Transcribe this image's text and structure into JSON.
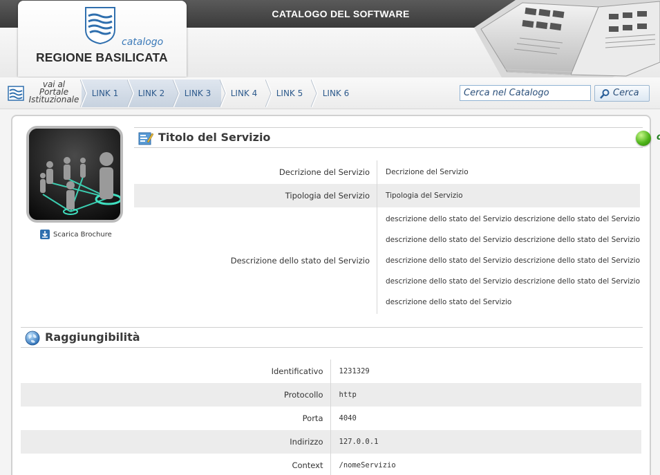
{
  "header": {
    "app_title": "CATALOGO DEL SOFTWARE",
    "logo_sub": "catalogo",
    "logo_main": "REGIONE BASILICATA"
  },
  "nav": {
    "portal_text": [
      "vai al",
      "Portale",
      "Istituzionale"
    ],
    "links": [
      {
        "label": "LINK 1",
        "active": true
      },
      {
        "label": "LINK 2",
        "active": true
      },
      {
        "label": "LINK 3",
        "active": true
      },
      {
        "label": "LINK 4",
        "active": false
      },
      {
        "label": "LINK 5",
        "active": false
      },
      {
        "label": "LINK 6",
        "active": false
      }
    ],
    "search_placeholder": "Cerca nel Catalogo",
    "search_button": "Cerca"
  },
  "service": {
    "brochure_label": "Scarica Brochure",
    "title": "Titolo del Servizio",
    "status": "online",
    "status_color": "#3fa811",
    "rows": [
      {
        "key": "Decrizione del Servizio",
        "value": "Decrizione del Servizio"
      },
      {
        "key": "Tipologia del Servizio",
        "value": "Tipologia del Servizio"
      }
    ],
    "stato_key": "Descrizione dello stato del Servizio",
    "stato_lines": [
      "descrizione dello stato del Servizio descrizione dello stato del Servizio",
      "descrizione dello stato del Servizio descrizione dello stato del Servizio",
      "descrizione dello stato del Servizio descrizione dello stato del Servizio",
      "descrizione dello stato del Servizio descrizione dello stato del Servizio",
      "descrizione dello stato del Servizio"
    ]
  },
  "reach": {
    "title": "Raggiungibilità",
    "rows": [
      {
        "key": "Identificativo",
        "value": "1231329"
      },
      {
        "key": "Protocollo",
        "value": "http"
      },
      {
        "key": "Porta",
        "value": "4040"
      },
      {
        "key": "Indirizzo",
        "value": "127.0.0.1"
      },
      {
        "key": "Context",
        "value": "/nomeServizio"
      }
    ]
  },
  "colors": {
    "accent": "#2d5a8c",
    "header_dark": "#444444"
  }
}
